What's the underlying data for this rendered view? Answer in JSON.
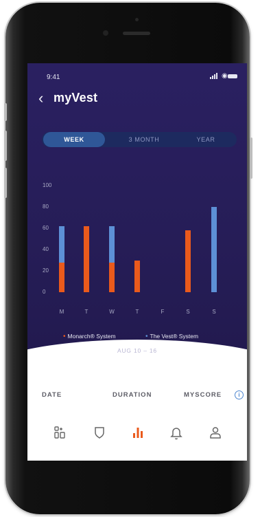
{
  "status": {
    "time": "9:41"
  },
  "header": {
    "back_icon": "chevron-left-icon",
    "title": "myVest"
  },
  "period_tabs": [
    {
      "label": "WEEK",
      "active": true
    },
    {
      "label": "3 MONTH",
      "active": false
    },
    {
      "label": "YEAR",
      "active": false
    }
  ],
  "chart_data": {
    "type": "bar",
    "stacked": true,
    "categories": [
      "M",
      "T",
      "W",
      "T",
      "F",
      "S",
      "S"
    ],
    "y_ticks": [
      "0",
      "20",
      "40",
      "60",
      "80",
      "100"
    ],
    "ylim": [
      0,
      100
    ],
    "series": [
      {
        "name": "Monarch® System",
        "color": "#ea5a1c",
        "values": [
          28,
          62,
          28,
          30,
          0,
          58,
          0
        ]
      },
      {
        "name": "The Vest® System",
        "color": "#5d90d6",
        "values": [
          34,
          0,
          34,
          0,
          0,
          0,
          80
        ]
      }
    ],
    "notes": "Tuesday: blue segment 0-28, orange segment 28-62 (orange drawn on top)"
  },
  "legend": [
    {
      "label": "Monarch® System",
      "color": "#ea5a1c"
    },
    {
      "label": "The Vest® System",
      "color": "#5d90d6"
    }
  ],
  "date_range": "AUG 10 – 16",
  "table_header": {
    "date": "DATE",
    "duration": "DURATION",
    "myscore": "MYSCORE"
  },
  "tabbar": [
    {
      "icon": "dashboard-icon",
      "active": false
    },
    {
      "icon": "shield-icon",
      "active": false
    },
    {
      "icon": "bar-chart-icon",
      "active": true
    },
    {
      "icon": "bell-icon",
      "active": false
    },
    {
      "icon": "profile-icon",
      "active": false
    }
  ],
  "colors": {
    "accent_orange": "#ea5a1c",
    "accent_blue": "#5d90d6",
    "header_bg": "#261d57"
  }
}
